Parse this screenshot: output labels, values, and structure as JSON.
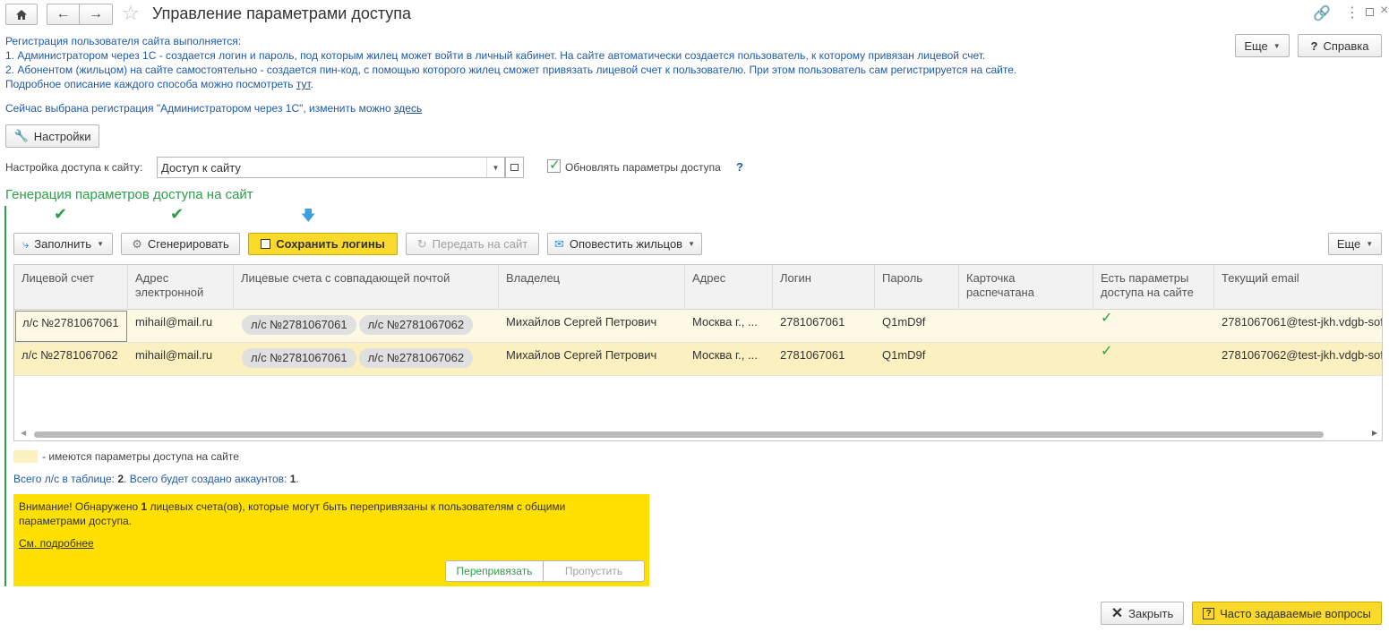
{
  "title": "Управление параметрами доступа",
  "intro": {
    "line1": "Регистрация пользователя сайта выполняется:",
    "line2": "1. Администратором через 1С - создается логин и пароль, под которым жилец может войти в личный кабинет. На сайте автоматически создается пользователь, к которому привязан лицевой счет.",
    "line3": "2. Абонентом (жильцом) на сайте самостоятельно - создается пин-код, с помощью которого жилец сможет привязать лицевой счет к пользователю. При этом пользователь сам регистрируется на сайте.",
    "line4_prefix": "Подробное описание каждого способа можно посмотреть ",
    "line4_link": "тут",
    "line4_suffix": ".",
    "current_prefix": "Сейчас выбрана регистрация \"Администратором через 1С\", изменить можно ",
    "current_link": "здесь"
  },
  "top_buttons": {
    "more": "Еще",
    "help": "Справка"
  },
  "settings_button": "Настройки",
  "access": {
    "label": "Настройка доступа к сайту:",
    "value": "Доступ к сайту",
    "update_checkbox_label": "Обновлять параметры доступа",
    "update_checked": true,
    "help_mark": "?"
  },
  "section_title": "Генерация параметров доступа на сайт",
  "toolbar": {
    "fill": "Заполнить",
    "generate": "Сгенерировать",
    "save_logins": "Сохранить логины",
    "send_to_site": "Передать на сайт",
    "notify": "Оповестить жильцов",
    "more": "Еще"
  },
  "table": {
    "columns": [
      "Лицевой счет",
      "Адрес электронной",
      "Лицевые счета с совпадающей почтой",
      "Владелец",
      "Адрес",
      "Логин",
      "Пароль",
      "Карточка распечатана",
      "Есть параметры доступа на сайте",
      "Текущий email"
    ],
    "column_lines": [
      [
        "Лицевой счет"
      ],
      [
        "Адрес",
        "электронной"
      ],
      [
        "Лицевые счета с совпадающей почтой"
      ],
      [
        "Владелец"
      ],
      [
        "Адрес"
      ],
      [
        "Логин"
      ],
      [
        "Пароль"
      ],
      [
        "Карточка распечатана"
      ],
      [
        "Есть параметры",
        "доступа на сайте"
      ],
      [
        "Текущий email"
      ]
    ],
    "rows": [
      {
        "account": "л/с №2781067061",
        "email": "mihail@mail.ru",
        "matching": [
          "л/с №2781067061",
          "л/с №2781067062"
        ],
        "owner": "Михайлов Сергей Петрович",
        "address": "Москва г., ...",
        "login": "2781067061",
        "password": "Q1mD9f",
        "card_printed": "",
        "has_access": true,
        "current_email": "2781067061@test-jkh.vdgb-sof"
      },
      {
        "account": "л/с №2781067062",
        "email": "mihail@mail.ru",
        "matching": [
          "л/с №2781067061",
          "л/с №2781067062"
        ],
        "owner": "Михайлов Сергей Петрович",
        "address": "Москва г., ...",
        "login": "2781067061",
        "password": "Q1mD9f",
        "card_printed": "",
        "has_access": true,
        "current_email": "2781067062@test-jkh.vdgb-sof"
      }
    ]
  },
  "legend_text": "- имеются параметры доступа на сайте",
  "summary": {
    "prefix": "Всего л/с в таблице: ",
    "total": "2",
    "middle": ". Всего будет создано аккаунтов: ",
    "accounts": "1",
    "suffix": "."
  },
  "warning": {
    "prefix": "Внимание! Обнаружено ",
    "count": "1",
    "suffix_line1": " лицевых счета(ов), которые могут быть перепривязаны к пользователям с общими",
    "line2": "параметрами доступа.",
    "more_link": "См. подробнее",
    "rebind": "Перепривязать",
    "skip": "Пропустить"
  },
  "bottom": {
    "close": "Закрыть",
    "faq": "Часто задаваемые вопросы"
  },
  "colors": {
    "accent_green": "#2e9e4a",
    "row_highlight": "#fbf0c0",
    "warning_bg": "#ffe000",
    "title_green": "#2e9e4a"
  }
}
